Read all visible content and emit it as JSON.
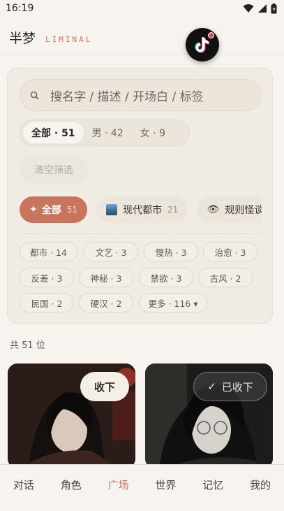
{
  "status": {
    "time": "16:19"
  },
  "header": {
    "title": "半梦",
    "subtitle": "LIMINAL"
  },
  "search": {
    "placeholder": "搜名字 / 描述 / 开场白 / 标签"
  },
  "gender_filter": [
    {
      "label": "全部 · 51",
      "active": true
    },
    {
      "label": "男 · 42",
      "active": false
    },
    {
      "label": "女 · 9",
      "active": false
    }
  ],
  "clear_button": "清空筛选",
  "categories": [
    {
      "label": "全部",
      "count": "51",
      "icon": "sparkle-icon",
      "active": true
    },
    {
      "label": "现代都市",
      "count": "21",
      "icon": "city-icon",
      "active": false
    },
    {
      "label": "规则怪谈",
      "count": "",
      "icon": "eye-icon",
      "active": false
    }
  ],
  "tags": [
    {
      "label": "都市 · 14"
    },
    {
      "label": "文艺 · 3"
    },
    {
      "label": "慢热 · 3"
    },
    {
      "label": "治愈 · 3"
    },
    {
      "label": "反差 · 3"
    },
    {
      "label": "神秘 · 3"
    },
    {
      "label": "禁欲 · 3"
    },
    {
      "label": "古风 · 2"
    },
    {
      "label": "民国 · 2"
    },
    {
      "label": "硬汉 · 2"
    },
    {
      "label": "更多 · 116 ▾"
    }
  ],
  "total": "共 51 位",
  "cards": [
    {
      "button": "收下",
      "collected": false
    },
    {
      "button": "已收下",
      "collected": true
    }
  ],
  "nav": [
    {
      "label": "对话",
      "active": false
    },
    {
      "label": "角色",
      "active": false
    },
    {
      "label": "广场",
      "active": true
    },
    {
      "label": "世界",
      "active": false
    },
    {
      "label": "记忆",
      "active": false
    },
    {
      "label": "我的",
      "active": false
    }
  ],
  "colors": {
    "accent": "#c9755d",
    "background": "#f7f4ef",
    "panel": "#f0ebe3"
  }
}
